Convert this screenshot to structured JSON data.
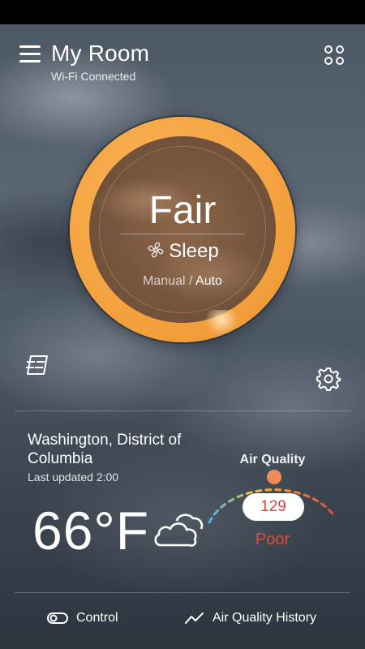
{
  "colors": {
    "dial_ring": "#F4A23F",
    "aq_poor": "#E04C44",
    "aq_gradient": [
      "#4FB3E8",
      "#F5C23A",
      "#F08A3C",
      "#E04C44"
    ]
  },
  "header": {
    "menu_icon": "hamburger-menu-icon",
    "title": "My Room",
    "subtitle": "Wi-Fi Connected",
    "apps_icon": "grid-apps-icon"
  },
  "dial": {
    "status": "Fair",
    "mode_icon": "fan-icon",
    "mode": "Sleep",
    "control_manual": "Manual",
    "control_separator": "/",
    "control_auto": "Auto",
    "selected_control": "Auto"
  },
  "actions": {
    "filter_icon": "filter-icon",
    "settings_icon": "gear-icon"
  },
  "weather": {
    "location": "Washington, District of Columbia",
    "updated": "Last updated 2:00",
    "temperature": "66°F",
    "condition_icon": "cloudy-icon"
  },
  "air_quality": {
    "label": "Air Quality",
    "value": "129",
    "level": "Poor"
  },
  "bottom_nav": {
    "items": [
      {
        "icon": "toggle-icon",
        "label": "Control"
      },
      {
        "icon": "trend-line-icon",
        "label": "Air Quality History"
      }
    ]
  }
}
